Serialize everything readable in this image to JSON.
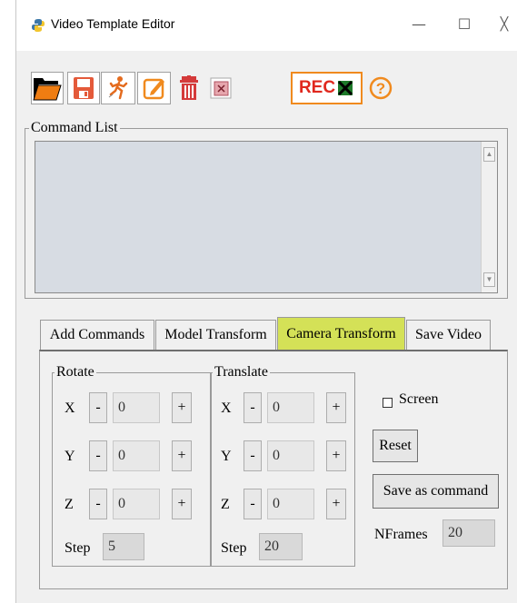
{
  "window": {
    "title": "Video Template Editor",
    "minimize_glyph": "—",
    "maximize_glyph": "☐",
    "close_glyph": "╳"
  },
  "toolbar": {
    "items": [
      {
        "name": "open-folder-icon"
      },
      {
        "name": "save-disk-icon"
      },
      {
        "name": "run-icon"
      },
      {
        "name": "edit-icon"
      },
      {
        "name": "trash-icon"
      },
      {
        "name": "clear-icon"
      },
      {
        "name": "record-icon",
        "label": "REC"
      },
      {
        "name": "help-icon",
        "label": "?"
      }
    ]
  },
  "command_list": {
    "label": "Command List",
    "items": []
  },
  "tabs": [
    {
      "label": "Add Commands",
      "active": false
    },
    {
      "label": "Model Transform",
      "active": false
    },
    {
      "label": "Camera Transform",
      "active": true
    },
    {
      "label": "Save Video",
      "active": false
    }
  ],
  "camera": {
    "rotate": {
      "label": "Rotate",
      "rows": [
        {
          "axis": "X",
          "value": "0"
        },
        {
          "axis": "Y",
          "value": "0"
        },
        {
          "axis": "Z",
          "value": "0"
        }
      ],
      "minus": "-",
      "plus": "+",
      "step_label": "Step",
      "step_value": "5"
    },
    "translate": {
      "label": "Translate",
      "rows": [
        {
          "axis": "X",
          "value": "0"
        },
        {
          "axis": "Y",
          "value": "0"
        },
        {
          "axis": "Z",
          "value": "0"
        }
      ],
      "minus": "-",
      "plus": "+",
      "step_label": "Step",
      "step_value": "20"
    },
    "screen_label": "Screen",
    "screen_checked": false,
    "reset_label": "Reset",
    "save_label": "Save as command",
    "nframes_label": "NFrames",
    "nframes_value": "20"
  },
  "colors": {
    "active_tab": "#d4e157",
    "listbox_bg": "#d7dce3",
    "window_bg": "#f0f0f0"
  }
}
